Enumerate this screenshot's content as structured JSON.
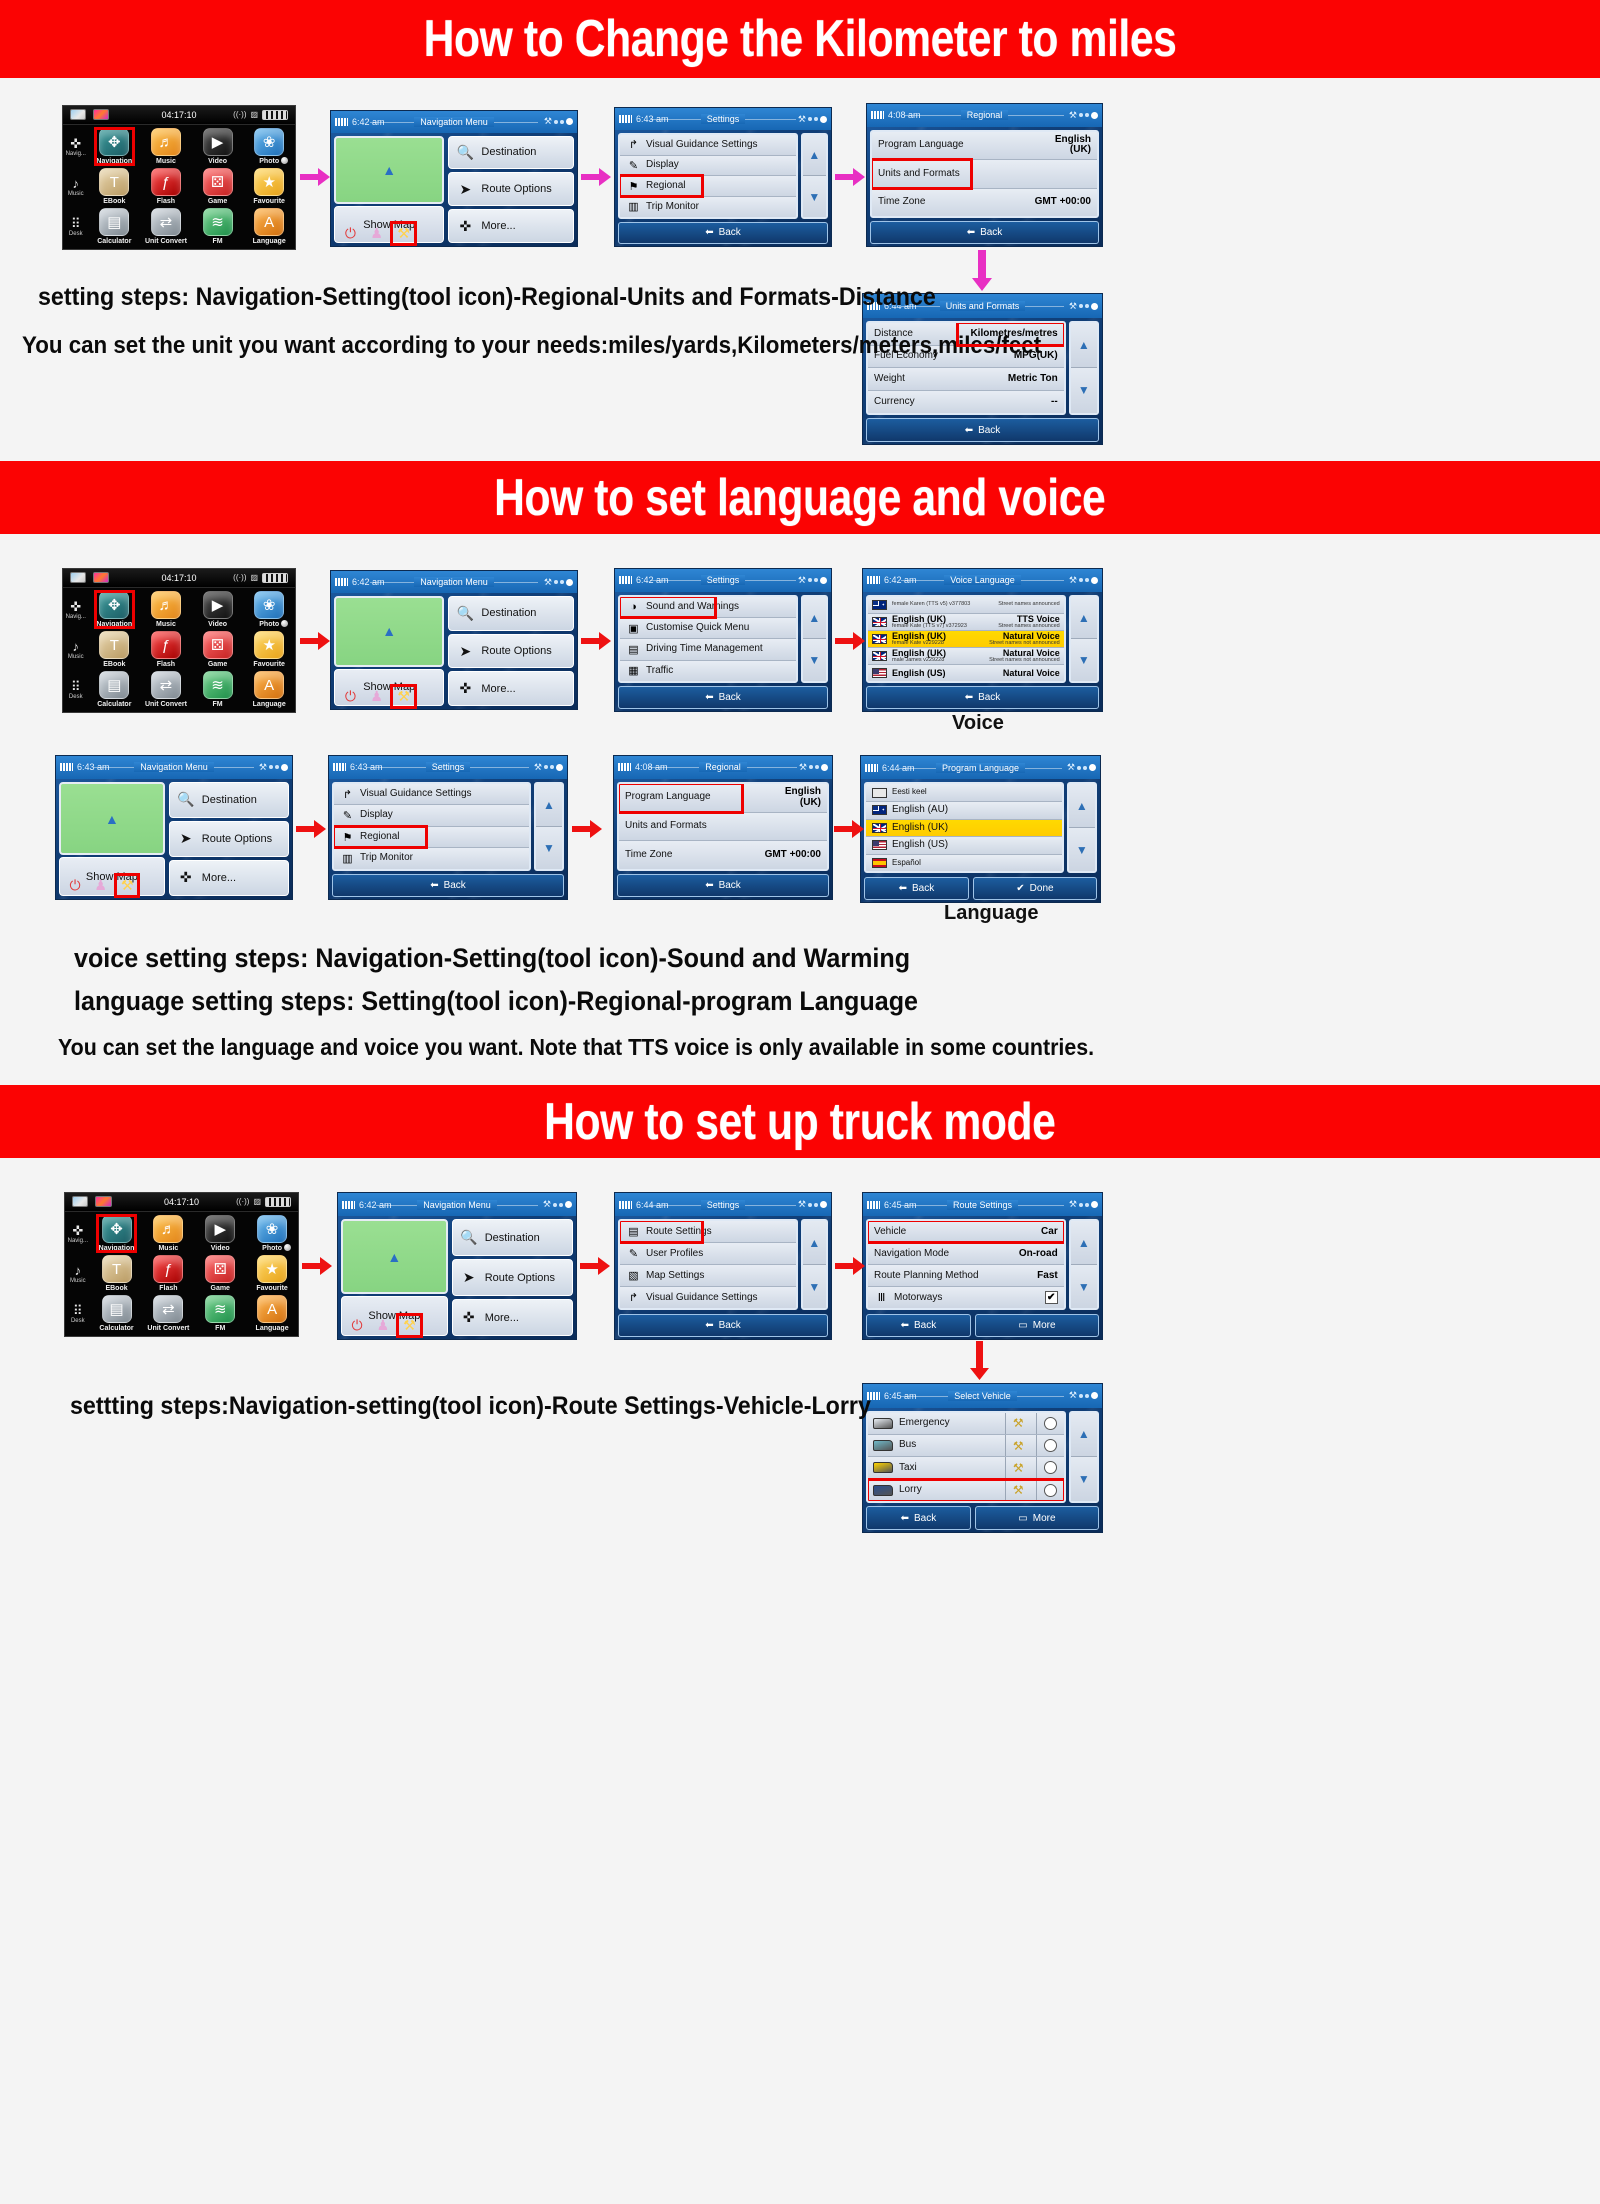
{
  "sections": [
    {
      "banner": "How to Change the Kilometer to miles",
      "captions": [
        "setting steps: Navigation-Setting(tool icon)-Regional-Units and Formats-Distance",
        "You can set the unit you want according to your needs:miles/yards,Kilometers/meters,miles/feet"
      ]
    },
    {
      "banner": "How to set language and voice",
      "captions": [
        "voice setting steps: Navigation-Setting(tool icon)-Sound and Warming",
        "language setting steps: Setting(tool icon)-Regional-program Language",
        "You can set the language and voice you want. Note that TTS voice is only available in some countries."
      ]
    },
    {
      "banner": "How to set up truck mode",
      "captions": [
        "settting steps:Navigation-setting(tool icon)-Route Settings-Vehicle-Lorry"
      ]
    }
  ],
  "launcher": {
    "time": "04:17:10",
    "rail": [
      {
        "label": "Navig...",
        "icon": "compass-icon"
      },
      {
        "label": "Music",
        "icon": "music-note-icon"
      },
      {
        "label": "Desk",
        "icon": "grid-icon"
      }
    ],
    "apps": [
      {
        "label": "Navigation",
        "icon": "navigation-icon",
        "selected": true
      },
      {
        "label": "Music",
        "icon": "music-icon",
        "selected": false
      },
      {
        "label": "Video",
        "icon": "video-icon",
        "selected": false
      },
      {
        "label": "Photo",
        "icon": "photo-icon",
        "selected": false
      },
      {
        "label": "EBook",
        "icon": "ebook-icon",
        "selected": false
      },
      {
        "label": "Flash",
        "icon": "flash-icon",
        "selected": false
      },
      {
        "label": "Game",
        "icon": "game-icon",
        "selected": false
      },
      {
        "label": "Favourite",
        "icon": "favourite-icon",
        "selected": false
      },
      {
        "label": "Calculator",
        "icon": "calculator-icon",
        "selected": false
      },
      {
        "label": "Unit Convert",
        "icon": "unit-convert-icon",
        "selected": false
      },
      {
        "label": "FM",
        "icon": "fm-icon",
        "selected": false
      },
      {
        "label": "Language",
        "icon": "language-icon",
        "selected": false
      }
    ]
  },
  "nav_menu": {
    "time": "6:42 am",
    "title": "Navigation Menu",
    "show_map": "Show Map",
    "buttons": [
      {
        "label": "Destination",
        "icon": "magnifier-icon"
      },
      {
        "label": "Route Options",
        "icon": "route-icon"
      },
      {
        "label": "More...",
        "icon": "puzzle-icon"
      }
    ],
    "bottom_icons": [
      "power-icon",
      "rocket-icon",
      "tools-icon"
    ]
  },
  "nav_menu_643": {
    "time": "6:43 am",
    "title": "Navigation Menu"
  },
  "settings_regional": {
    "time": "6:43 am",
    "title": "Settings",
    "back": "Back",
    "rows": [
      {
        "label": "Visual Guidance Settings",
        "icon": "guidance-icon",
        "highlight": false
      },
      {
        "label": "Display",
        "icon": "brush-icon",
        "highlight": false
      },
      {
        "label": "Regional",
        "icon": "flag-icon",
        "highlight": true
      },
      {
        "label": "Trip Monitor",
        "icon": "chart-icon",
        "highlight": false
      }
    ]
  },
  "regional": {
    "time": "4:08 am",
    "title": "Regional",
    "back": "Back",
    "rows": [
      {
        "label": "Program Language",
        "value": "English\n(UK)",
        "highlight": false
      },
      {
        "label": "Units and Formats",
        "value": "",
        "highlight": true
      },
      {
        "label": "Time Zone",
        "value": "GMT +00:00",
        "highlight": false
      }
    ]
  },
  "units": {
    "time": "6:44 am",
    "title": "Units and Formats",
    "back": "Back",
    "rows": [
      {
        "label": "Distance",
        "value": "Kilometres/metres",
        "highlight": true
      },
      {
        "label": "Fuel Economy",
        "value": "MPG(UK)",
        "highlight": false
      },
      {
        "label": "Weight",
        "value": "Metric Ton",
        "highlight": false
      },
      {
        "label": "Currency",
        "value": "--",
        "highlight": false
      }
    ]
  },
  "settings_sound": {
    "time": "6:42 am",
    "title": "Settings",
    "back": "Back",
    "rows": [
      {
        "label": "Sound and Warnings",
        "icon": "speaker-icon",
        "highlight": true
      },
      {
        "label": "Customise Quick Menu",
        "icon": "quickmenu-icon",
        "highlight": false
      },
      {
        "label": "Driving Time Management",
        "icon": "truck-icon",
        "highlight": false
      },
      {
        "label": "Traffic",
        "icon": "traffic-icon",
        "highlight": false
      }
    ]
  },
  "voice_language": {
    "time": "6:42 am",
    "title": "Voice Language",
    "back": "Back",
    "caption": "Voice",
    "rows": [
      {
        "name": "",
        "sub": "female Karen (TTS v5) v377803",
        "value": "",
        "note": "Street names announced",
        "flag": "au-flag-icon",
        "selected": false,
        "partial": true
      },
      {
        "name": "English (UK)",
        "sub": "female Kate (TTS v7) v372923",
        "value": "TTS Voice",
        "note": "Street names announced",
        "flag": "uk-flag-icon",
        "selected": false
      },
      {
        "name": "English (UK)",
        "sub": "female Kate v229228",
        "value": "Natural Voice",
        "note": "Street names not announced",
        "flag": "uk-flag-icon",
        "selected": true
      },
      {
        "name": "English (UK)",
        "sub": "male James v229228",
        "value": "Natural Voice",
        "note": "Street names not announced",
        "flag": "uk-flag-icon",
        "selected": false
      },
      {
        "name": "English (US)",
        "sub": "",
        "value": "Natural Voice",
        "note": "",
        "flag": "us-flag-icon",
        "selected": false
      }
    ]
  },
  "settings_regional2": {
    "time": "6:43 am",
    "title": "Settings",
    "back": "Back",
    "rows": [
      {
        "label": "Visual Guidance Settings",
        "icon": "guidance-icon",
        "highlight": false
      },
      {
        "label": "Display",
        "icon": "brush-icon",
        "highlight": false
      },
      {
        "label": "Regional",
        "icon": "flag-icon",
        "highlight": true
      },
      {
        "label": "Trip Monitor",
        "icon": "chart-icon",
        "highlight": false
      }
    ]
  },
  "regional2": {
    "time": "4:08 am",
    "title": "Regional",
    "back": "Back",
    "rows": [
      {
        "label": "Program Language",
        "value": "English\n(UK)",
        "highlight": true
      },
      {
        "label": "Units and Formats",
        "value": "",
        "highlight": false
      },
      {
        "label": "Time Zone",
        "value": "GMT +00:00",
        "highlight": false
      }
    ]
  },
  "program_language": {
    "time": "6:44 am",
    "title": "Program Language",
    "back": "Back",
    "done": "Done",
    "caption": "Language",
    "rows": [
      {
        "label": "Eesti keel",
        "flag": "ee-flag-icon",
        "selected": false,
        "partial": true
      },
      {
        "label": "English (AU)",
        "flag": "au-flag-icon",
        "selected": false
      },
      {
        "label": "English (UK)",
        "flag": "uk-flag-icon",
        "selected": true
      },
      {
        "label": "English (US)",
        "flag": "us-flag-icon",
        "selected": false
      },
      {
        "label": "Español",
        "flag": "es-flag-icon",
        "selected": false,
        "partial": true
      }
    ]
  },
  "settings_route": {
    "time": "6:44 am",
    "title": "Settings",
    "back": "Back",
    "rows": [
      {
        "label": "Route Settings",
        "icon": "signpost-icon",
        "highlight": true
      },
      {
        "label": "User Profiles",
        "icon": "profile-icon",
        "highlight": false
      },
      {
        "label": "Map Settings",
        "icon": "map-icon",
        "highlight": false
      },
      {
        "label": "Visual Guidance Settings",
        "icon": "guidance-icon",
        "highlight": false
      }
    ]
  },
  "route_settings": {
    "time": "6:45 am",
    "title": "Route Settings",
    "back": "Back",
    "more": "More",
    "rows": [
      {
        "label": "Vehicle",
        "value": "Car",
        "highlight": true
      },
      {
        "label": "Navigation Mode",
        "value": "On-road",
        "highlight": false
      },
      {
        "label": "Route Planning Method",
        "value": "Fast",
        "highlight": false
      },
      {
        "label": "Motorways",
        "value": "checked",
        "icon": "motorway-icon",
        "highlight": false
      }
    ]
  },
  "select_vehicle": {
    "time": "6:45 am",
    "title": "Select Vehicle",
    "back": "Back",
    "more": "More",
    "rows": [
      {
        "label": "Emergency",
        "icon": "ambulance-icon",
        "highlight": false
      },
      {
        "label": "Bus",
        "icon": "bus-icon",
        "highlight": false
      },
      {
        "label": "Taxi",
        "icon": "taxi-icon",
        "highlight": false
      },
      {
        "label": "Lorry",
        "icon": "lorry-icon",
        "highlight": true
      }
    ]
  },
  "colors": {
    "banner_red": "#fb0303",
    "highlight_red": "#ee0000",
    "arrow_magenta": "#e82fc3",
    "arrow_red": "#ee1111",
    "selected_yellow": "#ffd000",
    "page_bg": "#f4f4f4"
  }
}
